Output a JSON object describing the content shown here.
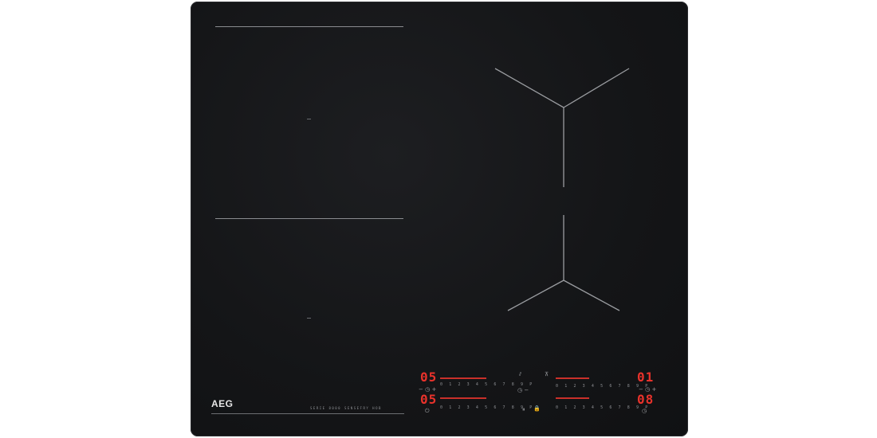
{
  "brand": {
    "logo_text": "AEG"
  },
  "model_label": "SERIE 8000 SENSEFRY HOB",
  "zones": {
    "front_left_display": "05",
    "rear_left_display": "05",
    "front_right_display": "01",
    "rear_right_display": "08"
  },
  "power_scale": "0 1 2 3 4 5 6 7 8 9 P",
  "symbols": {
    "timer_minus": "−",
    "timer_plus": "+",
    "clock": "◷",
    "lock": "🔒",
    "power": "⏻",
    "pause": "⏸",
    "bridge": "⫽",
    "hob2hood": "⊼"
  },
  "colors": {
    "glass": "#141517",
    "display_red": "#e8322b",
    "line_grey": "#8a8c90"
  }
}
